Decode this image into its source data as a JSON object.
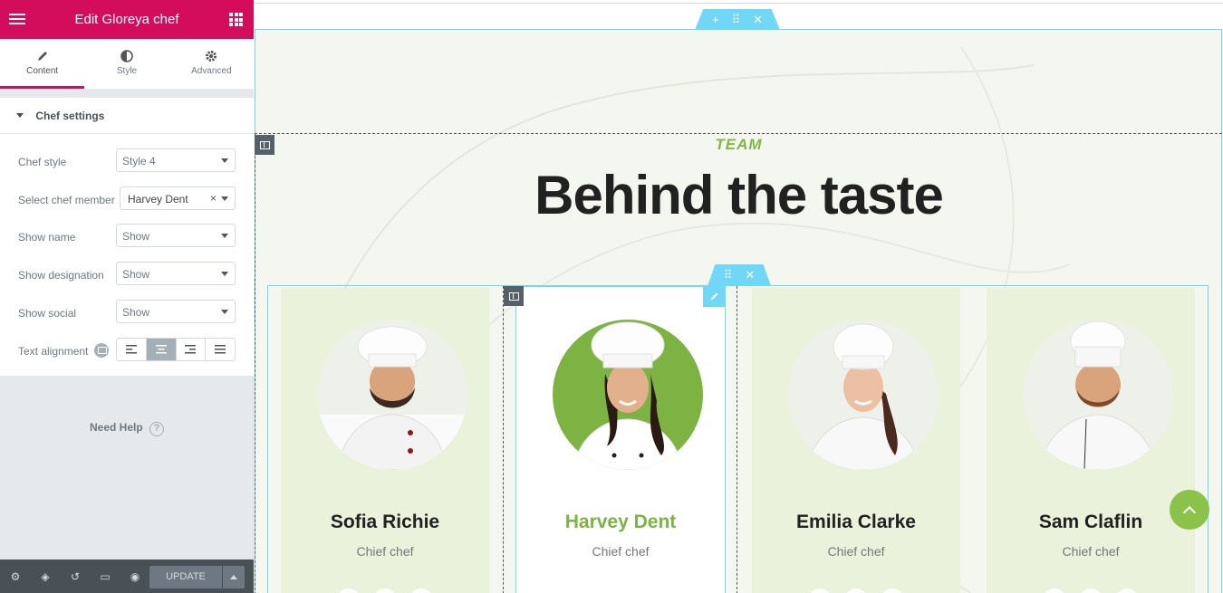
{
  "panel": {
    "title": "Edit Gloreya chef",
    "tabs": [
      {
        "label": "Content",
        "icon": "pencil-icon"
      },
      {
        "label": "Style",
        "icon": "half-circle-icon"
      },
      {
        "label": "Advanced",
        "icon": "gear-icon"
      }
    ],
    "section_title": "Chef settings",
    "fields": [
      {
        "label": "Chef style",
        "value": "Style 4"
      },
      {
        "label": "Select chef member",
        "value": "Harvey Dent"
      },
      {
        "label": "Show name",
        "value": "Show"
      },
      {
        "label": "Show designation",
        "value": "Show"
      },
      {
        "label": "Show social",
        "value": "Show"
      }
    ],
    "text_alignment_label": "Text alignment",
    "text_alignment_selected": "center",
    "need_help": "Need Help",
    "footer": {
      "update_label": "UPDATE"
    }
  },
  "canvas": {
    "kicker": "TEAM",
    "heading": "Behind the taste",
    "accent_color": "#7cb342",
    "chefs": [
      {
        "name": "Sofia Richie",
        "designation": "Chief chef"
      },
      {
        "name": "Harvey Dent",
        "designation": "Chief chef"
      },
      {
        "name": "Emilia Clarke",
        "designation": "Chief chef"
      },
      {
        "name": "Sam Claflin",
        "designation": "Chief chef"
      }
    ]
  }
}
